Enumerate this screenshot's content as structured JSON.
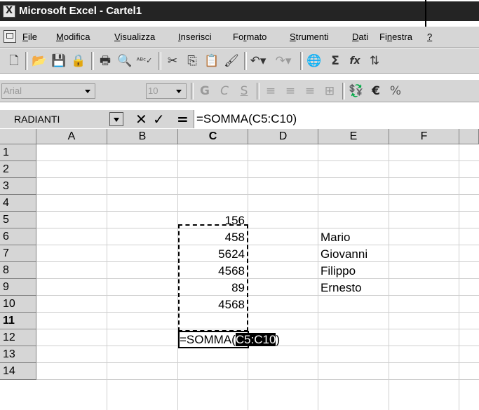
{
  "window": {
    "title": "Microsoft Excel - Cartel1"
  },
  "menu": [
    "File",
    "Modifica",
    "Visualizza",
    "Inserisci",
    "Formato",
    "Strumenti",
    "Dati",
    "Finestra",
    "?"
  ],
  "menu_underline": [
    "F",
    "M",
    "V",
    "I",
    "r",
    "S",
    "D",
    "n",
    "?"
  ],
  "toolbar": {
    "icons": [
      "new-icon",
      "open-icon",
      "save-icon",
      "permission-icon",
      "print-icon",
      "print-preview-icon",
      "spelling-icon",
      "cut-icon",
      "copy-icon",
      "paste-icon",
      "format-painter-icon",
      "undo-icon",
      "redo-icon",
      "hyperlink-icon",
      "autosum-icon",
      "function-icon",
      "sort-icon"
    ],
    "autosum_symbol": "Σ",
    "function_symbol": "fx"
  },
  "format_bar": {
    "font": "Arial",
    "size": "10",
    "bold": "G",
    "italic": "C",
    "underline": "S",
    "euro": "€",
    "percent": "%"
  },
  "formula_bar": {
    "name_box": "RADIANTI",
    "cancel_symbol": "✕",
    "enter_symbol": "✓",
    "equals_symbol": "=",
    "formula": "=SOMMA(C5:C10)"
  },
  "columns": [
    "A",
    "B",
    "C",
    "D",
    "E",
    "F"
  ],
  "rows": [
    "1",
    "2",
    "3",
    "4",
    "5",
    "6",
    "7",
    "8",
    "9",
    "10",
    "11",
    "12",
    "13",
    "14"
  ],
  "selected_column": "C",
  "selected_row": "11",
  "cells": {
    "C5": "156",
    "C6": "458",
    "C7": "5624",
    "C8": "4568",
    "C9": "89",
    "C10": "4568",
    "E6": "Mario",
    "E7": "Giovanni",
    "E8": "Filippo",
    "E9": "Ernesto"
  },
  "active_cell": {
    "ref": "C11",
    "text_prefix": "=SOMMA(",
    "text_range": "C5:C10",
    "text_suffix": ")"
  },
  "colors": {
    "titlebar": "#242424",
    "chrome": "#d6d6d6",
    "gridline": "#cfcfcf"
  }
}
